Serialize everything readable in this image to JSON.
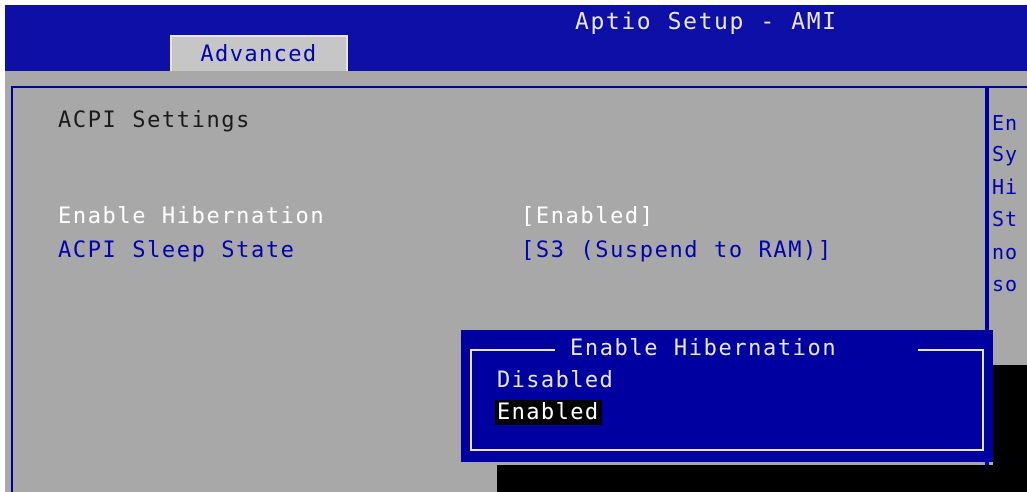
{
  "header": {
    "title": "Aptio Setup - AMI"
  },
  "tabs": [
    {
      "label": "Advanced",
      "active": true
    }
  ],
  "page": {
    "section_title": "ACPI Settings",
    "settings": [
      {
        "label": "Enable Hibernation",
        "value": "[Enabled]",
        "selected": true
      },
      {
        "label": "ACPI Sleep State",
        "value": "[S3 (Suspend to RAM)]",
        "selected": false
      }
    ]
  },
  "help_panel": {
    "lines": [
      "En",
      "Sy",
      "Hi",
      "St",
      "no",
      "so"
    ]
  },
  "popup": {
    "title": "Enable Hibernation",
    "options": [
      {
        "label": "Disabled",
        "highlighted": false
      },
      {
        "label": "Enabled",
        "highlighted": true
      }
    ]
  },
  "colors": {
    "header_bg": "#0d0fa6",
    "panel_bg": "#a8a8a8",
    "tab_bg": "#c6c6c6",
    "popup_bg": "#0000a0",
    "highlight_bg": "#000000",
    "label_blue": "#0000b0"
  }
}
